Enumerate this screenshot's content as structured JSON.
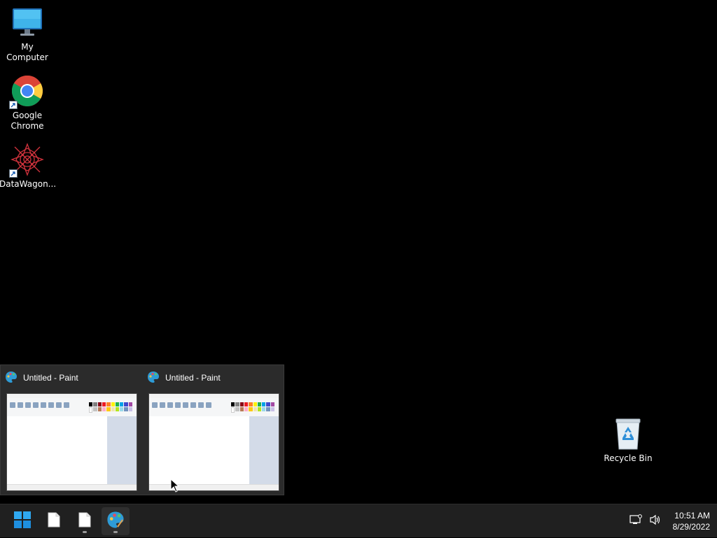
{
  "desktop": {
    "icons": [
      {
        "label": "My Computer",
        "icon": "monitor-icon"
      },
      {
        "label": "Google\nChrome",
        "label_line1": "Google",
        "label_line2": "Chrome",
        "icon": "chrome-icon"
      },
      {
        "label": "DataWagon...",
        "icon": "datawagon-icon"
      },
      {
        "label": "Recycle Bin",
        "icon": "recycle-bin-icon"
      }
    ]
  },
  "preview_flyout": {
    "thumbnails": [
      {
        "title": "Untitled - Paint",
        "icon": "paint-icon"
      },
      {
        "title": "Untitled - Paint",
        "icon": "paint-icon"
      }
    ]
  },
  "taskbar": {
    "start_icon": "windows-start-icon",
    "apps": [
      {
        "name": "file-1",
        "icon": "document-icon",
        "running": false
      },
      {
        "name": "file-2",
        "icon": "document-icon",
        "running": true
      },
      {
        "name": "paint",
        "icon": "paint-icon",
        "running": true,
        "active": true
      }
    ],
    "tray": {
      "network_icon": "network-icon",
      "volume_icon": "volume-icon",
      "time": "10:51 AM",
      "date": "8/29/2022"
    }
  },
  "colors": {
    "desktop_bg": "#000000",
    "taskbar_bg": "#202020",
    "accent": "#76b9ed"
  }
}
